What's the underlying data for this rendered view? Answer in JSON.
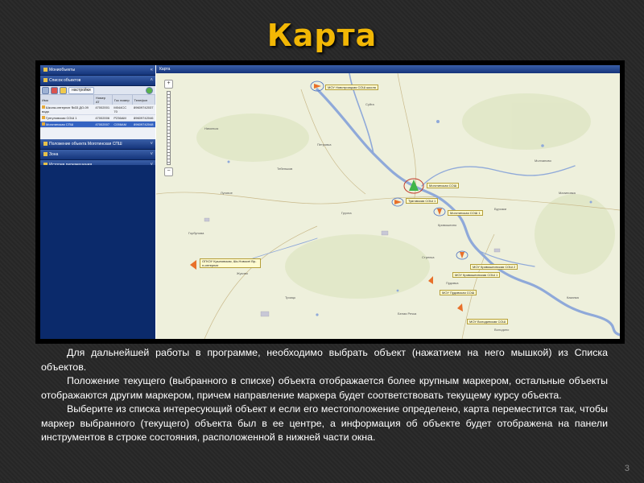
{
  "slide": {
    "title": "Карта",
    "page_number": "3",
    "paragraphs": [
      "Для дальнейшей работы в программе, необходимо выбрать объект (нажатием на него мышкой) из Списка объектов.",
      "Положение текущего (выбранного в списке) объекта отображается более крупным маркером, остальные объекты отображаются другим маркером, причем направление маркера будет соответствовать текущему курсу объекта.",
      "Выберите из списка интересующий объект и если его местоположение определено, карта переместится так, чтобы маркер выбранного (текущего) объекта был в ее центре, а информация об объекте будет отображена на панели инструментов в строке состояния, расположенной в нижней части окна."
    ]
  },
  "app": {
    "left_panel": {
      "top_header": "Мониобъекты",
      "objects_header": "Список объектов",
      "settings_label": "настройки",
      "columns": [
        "Имя",
        "Номер АТ",
        "Гос номер",
        "Телефон"
      ],
      "rows": [
        {
          "name": "Школа-интернат №33 ДО-09 вода",
          "num": "47002001",
          "plate": "М044СС 70",
          "phone": "89609742037",
          "selected": false
        },
        {
          "name": "Гунгуловская СОШ 1",
          "num": "47002006",
          "plate": "Р236АМ",
          "phone": "89609742046",
          "selected": false
        },
        {
          "name": "Моготинская СПШ",
          "num": "47002007",
          "plate": "С056АМ",
          "phone": "89609742048",
          "selected": true
        }
      ],
      "sections": [
        "Положение объекта Моготинская СПШ",
        "Зона",
        "История перемещения"
      ]
    },
    "map": {
      "header": "Карта",
      "zoom_in": "+",
      "zoom_out": "−",
      "callouts": [
        {
          "text": "МОУ Новотроицкая СОШ школа",
          "pos": "n-top"
        },
        {
          "text": "Моготинская СОШ",
          "pos": "center"
        },
        {
          "text": "Туяговская СОШ 1",
          "pos": "t1"
        },
        {
          "text": "Моготинская СОШ 1",
          "pos": "t2"
        },
        {
          "text": "ОГКОУ Крыловская, Шк-Новосеi Вр-п-интернат",
          "pos": "left"
        },
        {
          "text": "МОУ Кривошеинская СОШ 2",
          "pos": "k2"
        },
        {
          "text": "МОУ Кривошеинская СОШ 1",
          "pos": "k1"
        },
        {
          "text": "МОУ Пудовская СОШ",
          "pos": "pud"
        },
        {
          "text": "МОУ Володинская СОШ",
          "pos": "vol"
        }
      ],
      "place_names": [
        "Никольск",
        "Тебеньков",
        "Суйга",
        "Грухна",
        "Кривошеино",
        "Жуково",
        "Молчаново",
        "Горбунова",
        "Пудовка",
        "Володино",
        "Малиновка",
        "Петровка",
        "Казанка",
        "Стрелка",
        "Луговое",
        "Белая Речка",
        "Троицк",
        "Бурсаки"
      ]
    }
  },
  "colors": {
    "title": "#f2b705",
    "panel_blue": "#0b2a6b",
    "selected_row": "#3463c2",
    "river": "#8fa9d9",
    "marker_orange": "#e8702a",
    "marker_green": "#3fb54b"
  }
}
